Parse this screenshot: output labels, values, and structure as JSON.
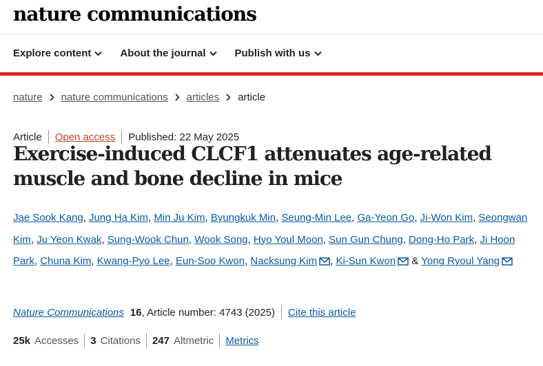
{
  "site": {
    "logo": "nature communications"
  },
  "nav": [
    {
      "label": "Explore content"
    },
    {
      "label": "About the journal"
    },
    {
      "label": "Publish with us"
    }
  ],
  "breadcrumb": [
    {
      "label": "nature"
    },
    {
      "label": "nature communications"
    },
    {
      "label": "articles"
    },
    {
      "label": "article"
    }
  ],
  "article": {
    "type": "Article",
    "access": "Open access",
    "published": "Published: 22 May 2025",
    "title": "Exercise-induced CLCF1 attenuates age-related muscle and bone decline in mice",
    "authors": [
      "Jae Sook Kang",
      "Jung Ha Kim",
      "Min Ju Kim",
      "Byungkuk Min",
      "Seung-Min Lee",
      "Ga-Yeon Go",
      "Ji-Won Kim",
      "Seongwan Kim",
      "Ju Yeon Kwak",
      "Sung-Wook Chun",
      "Wook Song",
      "Hyo Youl Moon",
      "Sun Gun Chung",
      "Dong-Ho Park",
      "Ji Hoon Park",
      "Chuna Kim",
      "Kwang-Pyo Lee",
      "Eun-Soo Kwon",
      "Nacksung Kim",
      "Ki-Sun Kwon",
      "Yong Ryoul Yang"
    ],
    "author_sep": ", ",
    "author_and": " & ",
    "journal": "Nature Communications",
    "volume": "16",
    "article_number": ", Article number: 4743 (2025)",
    "cite_label": "Cite this article"
  },
  "metrics": {
    "accesses_value": "25k",
    "accesses_label": "Accesses",
    "citations_value": "3",
    "citations_label": "Citations",
    "altmetric_value": "247",
    "altmetric_label": "Altmetric",
    "metrics_link": "Metrics"
  },
  "colors": {
    "accent_red": "#e0261b",
    "link_blue": "#0a5ba4",
    "open_access": "#b8491c"
  },
  "icons": {
    "nav_chevron": "chevron-down-icon",
    "breadcrumb_sep": "chevron-right-icon",
    "corresponding": "mail-icon"
  }
}
